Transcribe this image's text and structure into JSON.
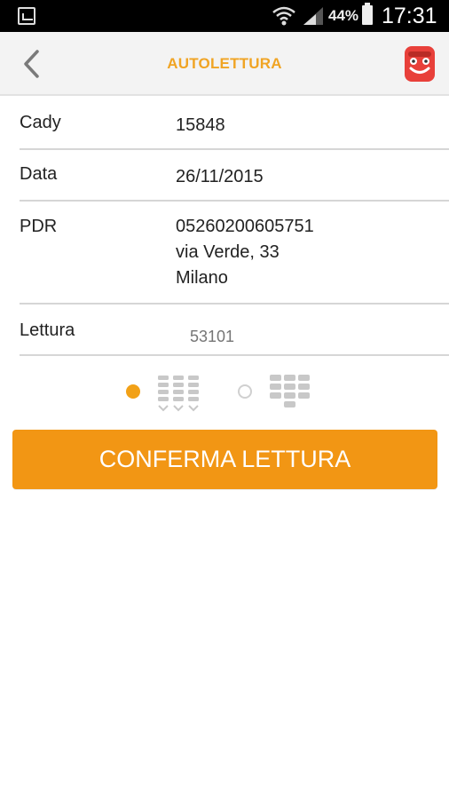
{
  "status_bar": {
    "battery_percent": "44%",
    "time": "17:31",
    "icons": [
      "gallery-notification-icon",
      "wifi-icon",
      "signal-icon",
      "battery-icon"
    ]
  },
  "header": {
    "title": "AUTOLETTURA",
    "back_icon": "chevron-left-icon",
    "mascot_icon": "mascot-icon"
  },
  "fields": {
    "cady": {
      "label": "Cady",
      "value": "15848"
    },
    "data": {
      "label": "Data",
      "value": "26/11/2015"
    },
    "pdr": {
      "label": "PDR",
      "lines": [
        "05260200605751",
        "via Verde, 33",
        "Milano"
      ]
    },
    "lettura": {
      "label": "Lettura",
      "placeholder": "53101"
    }
  },
  "input_mode": {
    "options": [
      {
        "icon": "roller-digits-icon",
        "selected": true
      },
      {
        "icon": "keypad-digits-icon",
        "selected": false
      }
    ]
  },
  "confirm_button": {
    "label": "CONFERMA LETTURA"
  },
  "colors": {
    "accent": "#f29614",
    "title": "#f0a424",
    "mascot": "#e8403a",
    "divider": "#d6d6d6",
    "icon_gray": "#c8c8c8"
  }
}
